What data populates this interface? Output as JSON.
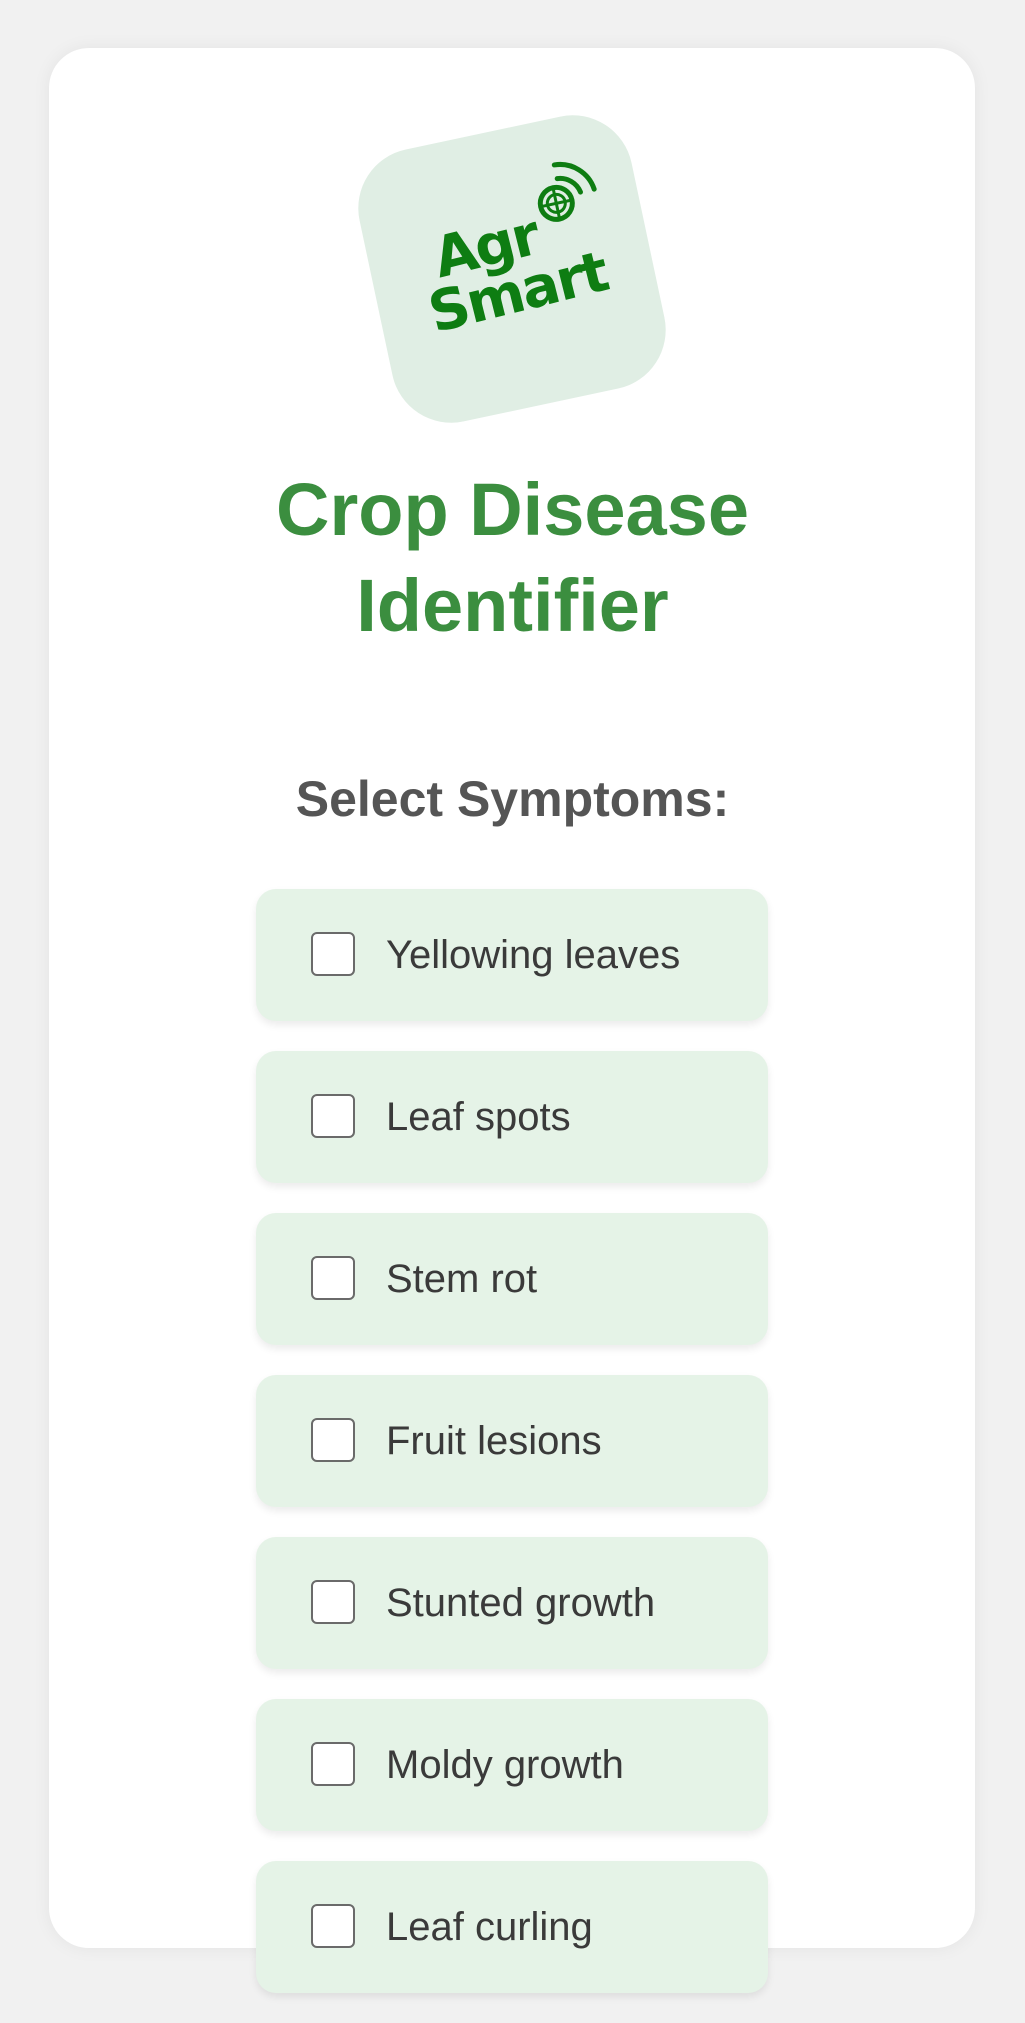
{
  "logo": {
    "line1": "Agr",
    "line2": "Smart"
  },
  "title": "Crop Disease Identifier",
  "subtitle": "Select Symptoms:",
  "symptoms": [
    {
      "label": "Yellowing leaves",
      "checked": false
    },
    {
      "label": "Leaf spots",
      "checked": false
    },
    {
      "label": "Stem rot",
      "checked": false
    },
    {
      "label": "Fruit lesions",
      "checked": false
    },
    {
      "label": "Stunted growth",
      "checked": false
    },
    {
      "label": "Moldy growth",
      "checked": false
    },
    {
      "label": "Leaf curling",
      "checked": false
    }
  ],
  "colors": {
    "brand_green": "#0e7d12",
    "title_green": "#3b8e3f",
    "symptom_bg": "#e5f3e7",
    "logo_bg": "#e0eee4"
  }
}
